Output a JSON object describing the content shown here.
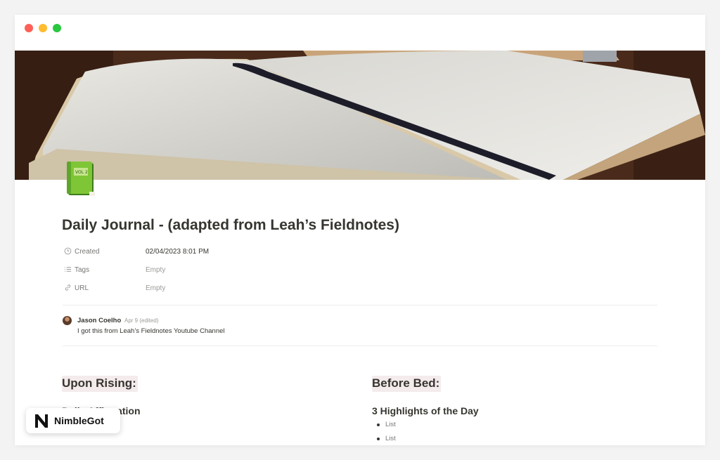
{
  "window": {
    "controls": [
      "close",
      "minimize",
      "maximize"
    ],
    "colors": {
      "close": "#fe5f57",
      "minimize": "#febc2e",
      "maximize": "#28c840"
    }
  },
  "page": {
    "title": "Daily Journal - (adapted from Leah’s Fieldnotes)",
    "icon": "green-notebook-icon",
    "cover": "open-notebook-photo"
  },
  "properties": [
    {
      "icon": "clock-icon",
      "name": "Created",
      "value": "02/04/2023 8:01 PM"
    },
    {
      "icon": "list-icon",
      "name": "Tags",
      "value": "Empty"
    },
    {
      "icon": "link-icon",
      "name": "URL",
      "value": "Empty"
    }
  ],
  "comment": {
    "author": "Jason Coelho",
    "meta": "Apr 9 (edited)",
    "text": "I got this from Leah’s Fieldnotes Youtube Channel"
  },
  "sections": {
    "left": {
      "heading": "Upon Rising:",
      "subheading": "Daily Affirmation"
    },
    "right": {
      "heading": "Before Bed:",
      "subheading": "3 Highlights of the Day",
      "items": [
        "List",
        "List"
      ]
    }
  },
  "badge": {
    "logo": "N",
    "label": "NimbleGot"
  },
  "colors": {
    "accent_highlight": "#f4ebec",
    "text": "#37352f",
    "muted": "#9b9a97"
  }
}
